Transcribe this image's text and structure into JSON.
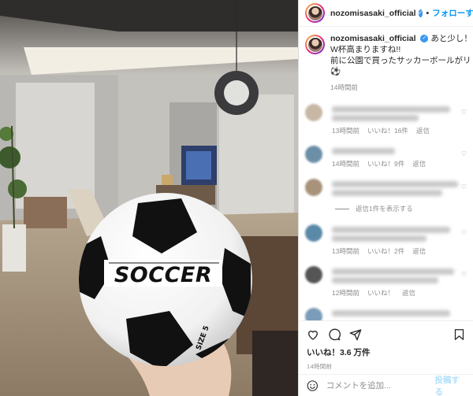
{
  "colors": {
    "link": "#0095f6",
    "muted": "#8e8e8e",
    "text": "#262626",
    "verified": "#3897f0"
  },
  "header": {
    "username": "nozomisasaki_official",
    "separator": "•",
    "follow_label": "フォローする"
  },
  "caption": {
    "username": "nozomisasaki_official",
    "lines": [
      "あと少し！",
      "W杯高まりますね!!",
      "前に公園で買ったサッカーボールがリビング",
      "⚽"
    ],
    "time": "14時間前"
  },
  "photo": {
    "ball_text": "SOCCER",
    "size_label": "SIZE 5"
  },
  "comments": [
    {
      "time": "13時間前",
      "likes": "いいね！16件",
      "reply": "返信"
    },
    {
      "time": "14時間前",
      "likes": "いいね！9件",
      "reply": "返信"
    },
    {
      "time": "",
      "likes": "",
      "reply": ""
    },
    {
      "time": "13時間前",
      "likes": "いいね！2件",
      "reply": "返信"
    },
    {
      "time": "12時間前",
      "likes": "いいね！",
      "reply": "返信"
    }
  ],
  "view_replies": "返信1件を表示する",
  "actions": {
    "likes": "いいね！3.6 万件",
    "time": "14時間前"
  },
  "comment_input": {
    "placeholder": "コメントを追加...",
    "post_label": "投稿する"
  },
  "icons": [
    "heart-icon",
    "comment-icon",
    "share-icon",
    "save-icon",
    "emoji-icon",
    "verified-icon"
  ]
}
